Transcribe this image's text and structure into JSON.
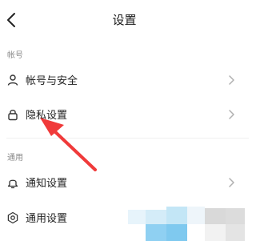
{
  "header": {
    "title": "设置",
    "back_icon": "chevron-left-icon"
  },
  "sections": [
    {
      "label": "帐号",
      "items": [
        {
          "label": "帐号与安全",
          "icon": "user-icon"
        },
        {
          "label": "隐私设置",
          "icon": "lock-icon"
        }
      ]
    },
    {
      "label": "通用",
      "items": [
        {
          "label": "通知设置",
          "icon": "bell-icon"
        },
        {
          "label": "通用设置",
          "icon": "gear-icon"
        }
      ]
    }
  ],
  "annotation": {
    "color": "#f03a3a",
    "points_to": "隐私设置"
  },
  "colors": {
    "text": "#222222",
    "section_label": "#8a8a8a",
    "chevron": "#b0b0b0",
    "divider": "#f0f0f0",
    "background": "#ffffff"
  }
}
